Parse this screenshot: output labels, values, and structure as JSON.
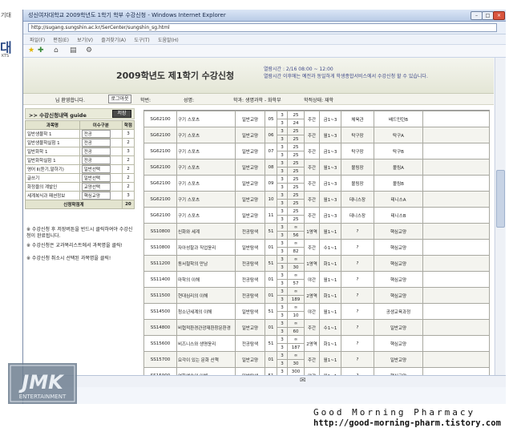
{
  "left_strip": {
    "top_text": "기대",
    "logo_char": "대",
    "small_text": "KTS"
  },
  "window": {
    "title": "성신여자대학교 2009학년도 1학기 학부 수강신청 - Windows Internet Explorer",
    "url": "http://sugang.sungshin.ac.kr/SerCenter/sungshin_sg.html",
    "menu": [
      "파일(F)",
      "편집(E)",
      "보기(V)",
      "즐겨찾기(A)",
      "도구(T)",
      "도움말(H)"
    ]
  },
  "header": {
    "title": "2009학년도 제1학기 수강신청",
    "period_line1": "열람시간 : 2/16 08:00 ~ 12:00",
    "period_line2": "열람시간 이후에는 예전과 동일하게 학생종합서비스에서 수강신청 할 수 있습니다."
  },
  "info_bar": {
    "greeting": "님 환영합니다.",
    "logout": "로그아웃",
    "student_no_label": "학번:",
    "name_label": "성명:",
    "dept_label": "학과: 생명과학 - 화학부",
    "status_label": "학적상태: 재학"
  },
  "sidebar": {
    "section_title": ">> 수강신청내역 guide",
    "save_label": "저장",
    "headers": [
      "과목명",
      "이수구분",
      "학점"
    ],
    "rows": [
      {
        "name": "일반생물학 1",
        "type": "전공",
        "credit": "3"
      },
      {
        "name": "일반생물학실험 1",
        "type": "전공",
        "credit": "2"
      },
      {
        "name": "일반화학 1",
        "type": "전공",
        "credit": "3"
      },
      {
        "name": "일반화학실험 1",
        "type": "전공",
        "credit": "2"
      },
      {
        "name": "영어 Ⅱ(듣기,말하기)",
        "type": "일반선택",
        "credit": "2"
      },
      {
        "name": "글쓰기",
        "type": "일반선택",
        "credit": "2"
      },
      {
        "name": "화정을의 계발인",
        "type": "교양선택",
        "credit": "2"
      },
      {
        "name": "세계복식과 패션정보",
        "type": "핵심교양",
        "credit": "3"
      }
    ],
    "total_label": "신청학점계",
    "total_value": "20",
    "notes": [
      "※ 수강신청 후 저장버튼을 반드시 클릭하여야 수강신청이 완료됩니다.",
      "※ 수강신청은 교과목리스트에서 과목명을 클릭!",
      "※ 수강신청 취소시 선택된 과목명을 클릭!"
    ]
  },
  "courses": [
    {
      "code": "SG62100",
      "name": "구기 스포츠",
      "type": "일반교양",
      "sec": "05",
      "a": "3",
      "b": "3",
      "c": "25",
      "d": "24",
      "day": "주간",
      "time": "금1~3",
      "room": "체육관",
      "prof": "배드민턴B"
    },
    {
      "code": "SG62100",
      "name": "구기 스포츠",
      "type": "일반교양",
      "sec": "06",
      "a": "3",
      "b": "3",
      "c": "25",
      "d": "25",
      "day": "주간",
      "time": "월1~3",
      "room": "탁구장",
      "prof": "탁구A"
    },
    {
      "code": "SG62100",
      "name": "구기 스포츠",
      "type": "일반교양",
      "sec": "07",
      "a": "3",
      "b": "3",
      "c": "25",
      "d": "25",
      "day": "주간",
      "time": "금1~3",
      "room": "탁구장",
      "prof": "탁구B"
    },
    {
      "code": "SG62100",
      "name": "구기 스포츠",
      "type": "일반교양",
      "sec": "08",
      "a": "3",
      "b": "3",
      "c": "25",
      "d": "25",
      "day": "주간",
      "time": "월1~3",
      "room": "볼링장",
      "prof": "볼링A"
    },
    {
      "code": "SG62100",
      "name": "구기 스포츠",
      "type": "일반교양",
      "sec": "09",
      "a": "3",
      "b": "3",
      "c": "25",
      "d": "25",
      "day": "주간",
      "time": "금1~3",
      "room": "볼링장",
      "prof": "볼링B"
    },
    {
      "code": "SG62100",
      "name": "구기 스포츠",
      "type": "일반교양",
      "sec": "10",
      "a": "3",
      "b": "3",
      "c": "25",
      "d": "25",
      "day": "주간",
      "time": "월1~3",
      "room": "데니스장",
      "prof": "테니스A"
    },
    {
      "code": "SG62100",
      "name": "구기 스포츠",
      "type": "일반교양",
      "sec": "11",
      "a": "3",
      "b": "3",
      "c": "25",
      "d": "25",
      "day": "주간",
      "time": "금1~3",
      "room": "데니스장",
      "prof": "테니스B"
    },
    {
      "code": "SS10800",
      "name": "신화와 세계",
      "type": "전공탐색",
      "sec": "51",
      "a": "3",
      "b": "3",
      "c": "∞",
      "d": "56",
      "day": "1영역",
      "time": "월1~1",
      "room": "?",
      "prof": "핵심교양"
    },
    {
      "code": "SS10800",
      "name": "자아성찰과 직업윤리",
      "type": "일반탐색",
      "sec": "01",
      "a": "3",
      "b": "3",
      "c": "∞",
      "d": "82",
      "day": "주간",
      "time": "수1~1",
      "room": "?",
      "prof": "핵심교양"
    },
    {
      "code": "SS11200",
      "name": "동서철학의 만남",
      "type": "전공탐색",
      "sec": "51",
      "a": "3",
      "b": "3",
      "c": "∞",
      "d": "30",
      "day": "1영역",
      "time": "화1~1",
      "room": "?",
      "prof": "핵심교양"
    },
    {
      "code": "SS11400",
      "name": "마학의 이해",
      "type": "전공탐색",
      "sec": "01",
      "a": "3",
      "b": "3",
      "c": "∞",
      "d": "57",
      "day": "야간",
      "time": "월1~1",
      "room": "?",
      "prof": "핵심교양"
    },
    {
      "code": "SS11500",
      "name": "현대심리의 이해",
      "type": "전공탐색",
      "sec": "01",
      "a": "3",
      "b": "3",
      "c": "∞",
      "d": "189",
      "day": "2영역",
      "time": "화1~1",
      "room": "?",
      "prof": "핵심교양"
    },
    {
      "code": "SS14500",
      "name": "청소년세계의 이해",
      "type": "일반탐색",
      "sec": "51",
      "a": "3",
      "b": "3",
      "c": "∞",
      "d": "10",
      "day": "야간",
      "time": "월1~1",
      "room": "?",
      "prof": "공생교육과정"
    },
    {
      "code": "SS14800",
      "name": "비협적환경관광재환창문환경",
      "type": "일반교양",
      "sec": "01",
      "a": "3",
      "b": "3",
      "c": "∞",
      "d": "60",
      "day": "주간",
      "time": "수1~1",
      "room": "?",
      "prof": "일반교양"
    },
    {
      "code": "SS15600",
      "name": "비즈니스와 생명윤리",
      "type": "전공탐색",
      "sec": "51",
      "a": "3",
      "b": "3",
      "c": "∞",
      "d": "187",
      "day": "2영역",
      "time": "화1~1",
      "room": "?",
      "prof": "핵심교양"
    },
    {
      "code": "SS15700",
      "name": "요각이 있는 문화 산책",
      "type": "일반교양",
      "sec": "01",
      "a": "3",
      "b": "3",
      "c": "∞",
      "d": "30",
      "day": "주간",
      "time": "월1~1",
      "room": "?",
      "prof": "일반교양"
    },
    {
      "code": "SS15900",
      "name": "영화예술의 이해",
      "type": "일반탐색",
      "sec": "51",
      "a": "3",
      "b": "3",
      "c": "300",
      "d": "270",
      "day": "야간",
      "time": "월1~1",
      "room": "?",
      "prof": "핵심교양"
    },
    {
      "code": "SS24500",
      "name": "세계복식과 패션정보",
      "type": "전공탐색",
      "sec": "01",
      "a": "3",
      "b": "3",
      "c": "∞",
      "d": "209",
      "day": "4영역",
      "time": "수1~1",
      "room": "?",
      "prof": "핵심교양"
    }
  ],
  "footer": {
    "title": "Good Morning Pharmacy",
    "url": "http://good-morning-pharm.tistory.com",
    "logo_text": "JMK",
    "logo_sub": "ENTERTAINMENT"
  }
}
